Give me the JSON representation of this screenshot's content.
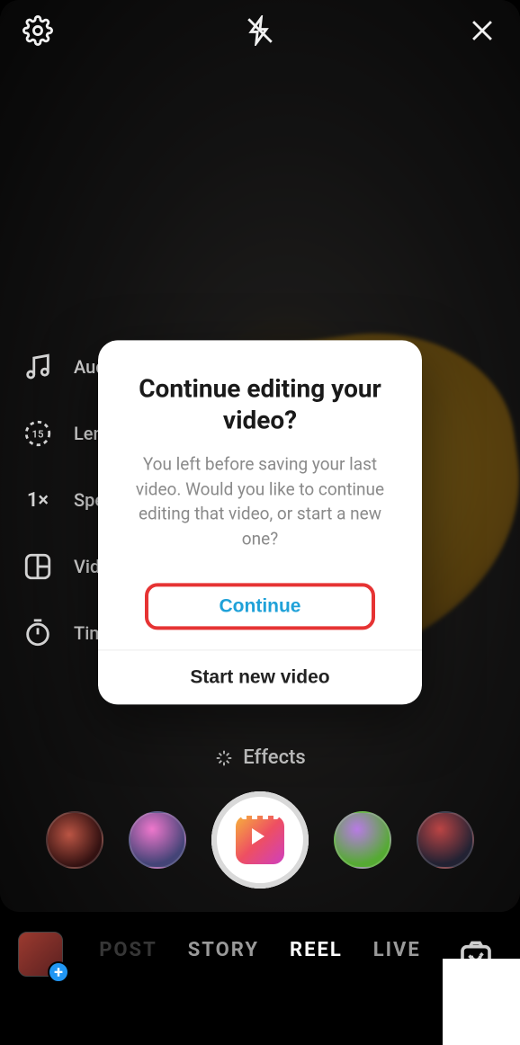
{
  "topbar": {
    "settings_icon": "settings",
    "flash_icon": "flash-off",
    "close_icon": "close"
  },
  "side_tools": {
    "audio": {
      "label": "Audio"
    },
    "length": {
      "label": "Length",
      "value": "15"
    },
    "speed": {
      "label": "Speed",
      "value": "1×"
    },
    "layout": {
      "label": "Video layout"
    },
    "timer": {
      "label": "Timer"
    }
  },
  "effects": {
    "label": "Effects"
  },
  "modes": {
    "items": [
      "POST",
      "STORY",
      "REEL",
      "LIVE"
    ],
    "active_index": 2
  },
  "modal": {
    "title": "Continue editing your video?",
    "body": "You left before saving your last video. Would you like to continue editing that video, or start a new one?",
    "continue_label": "Continue",
    "start_label": "Start new video"
  }
}
